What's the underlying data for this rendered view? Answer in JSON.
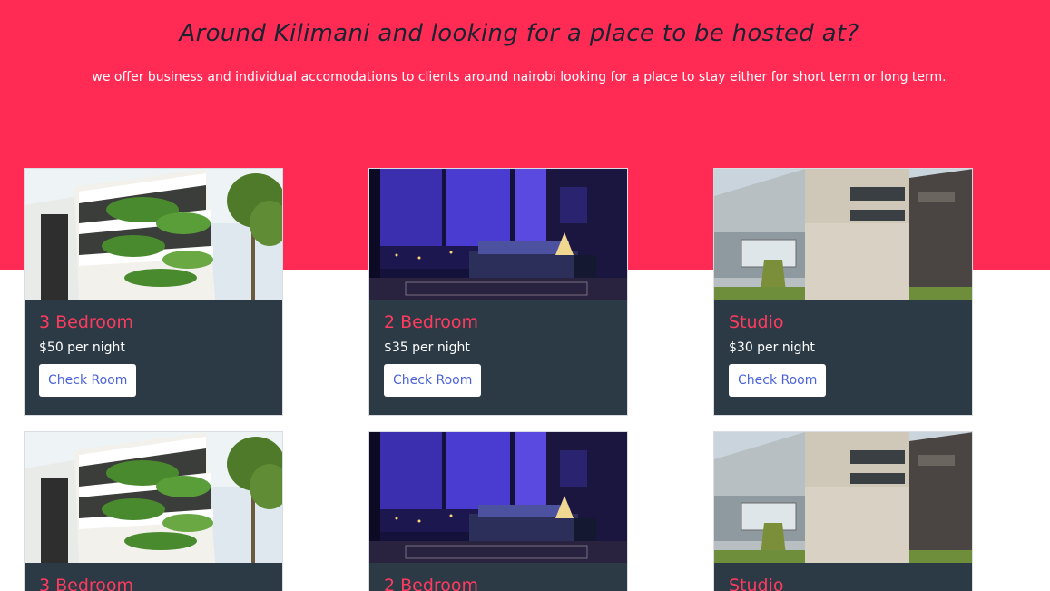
{
  "hero": {
    "title": "Around Kilimani and looking for a place to be hosted at?",
    "subtitle": "we offer business and individual accomodations to clients around nairobi looking for a place to stay either for short term or long term."
  },
  "rooms": [
    {
      "title": "3 Bedroom",
      "price": "$50 per night",
      "button": "Check Room",
      "image": "building-photo"
    },
    {
      "title": "2 Bedroom",
      "price": "$35 per night",
      "button": "Check Room",
      "image": "night-bedroom-photo"
    },
    {
      "title": "Studio",
      "price": "$30 per night",
      "button": "Check Room",
      "image": "townhouse-photo"
    },
    {
      "title": "3 Bedroom",
      "price": "",
      "button": "",
      "image": "building-photo"
    },
    {
      "title": "2 Bedroom",
      "price": "",
      "button": "",
      "image": "night-bedroom-photo"
    },
    {
      "title": "Studio",
      "price": "",
      "button": "",
      "image": "townhouse-photo"
    }
  ],
  "colors": {
    "hero_bg": "#ff2b55",
    "card_bg": "#2c3a46",
    "card_title": "#ff3a5f",
    "button_text": "#4b63d8"
  }
}
